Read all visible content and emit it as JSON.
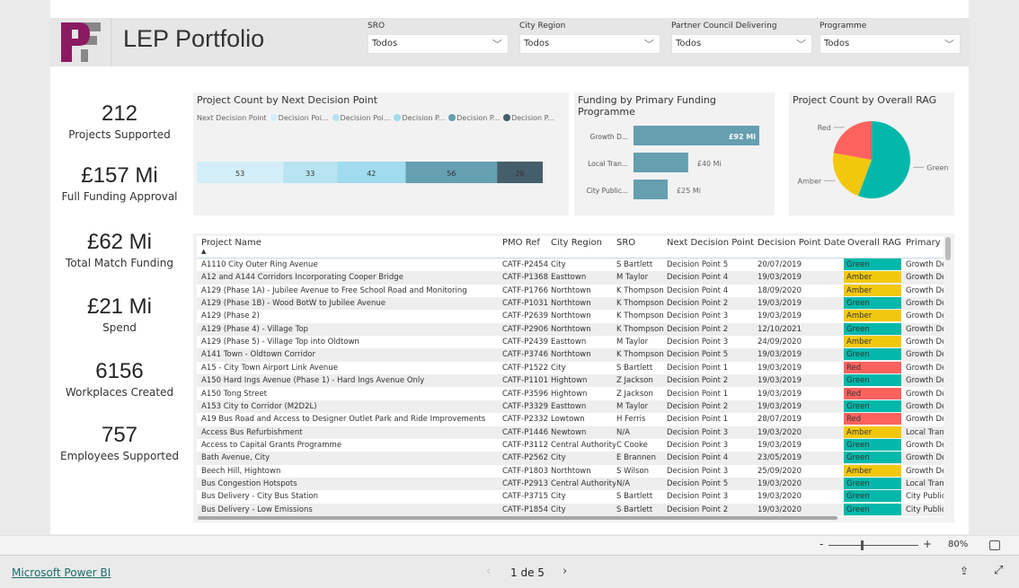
{
  "header": {
    "title": "LEP Portfolio",
    "logo_text": "PF",
    "filters": [
      {
        "label": "SRO",
        "value": "Todos"
      },
      {
        "label": "City Region",
        "value": "Todos"
      },
      {
        "label": "Partner Council Delivering",
        "value": "Todos"
      },
      {
        "label": "Programme",
        "value": "Todos"
      }
    ]
  },
  "kpis": [
    {
      "value": "212",
      "label": "Projects Supported"
    },
    {
      "value": "£157 Mi",
      "label": "Full Funding Approval"
    },
    {
      "value": "£62 Mi",
      "label": "Total Match Funding"
    },
    {
      "value": "£21 Mi",
      "label": "Spend"
    },
    {
      "value": "6156",
      "label": "Workplaces Created"
    },
    {
      "value": "757",
      "label": "Employees Supported"
    }
  ],
  "chart_data": [
    {
      "type": "bar",
      "orientation": "horizontal-stacked",
      "title": "Project Count by Next Decision Point",
      "legend_title": "Next Decision Point",
      "legend_position": "top",
      "legend_labels": [
        "Decision Poi...",
        "Decision Poi...",
        "Decision P...",
        "Decision P...",
        "Decision P..."
      ],
      "series": [
        {
          "name": "Decision Point 1",
          "value": 53,
          "color": "#d3eef8"
        },
        {
          "name": "Decision Point 2",
          "value": 33,
          "color": "#b8e3f2"
        },
        {
          "name": "Decision Point 3",
          "value": 42,
          "color": "#a0dbee"
        },
        {
          "name": "Decision Point 4",
          "value": 56,
          "color": "#659fb0"
        },
        {
          "name": "Decision Point 5",
          "value": 28,
          "color": "#445f6b"
        }
      ]
    },
    {
      "type": "bar",
      "orientation": "horizontal",
      "title": "Funding by Primary Funding Programme",
      "categories": [
        "Growth D...",
        "Local Tran...",
        "City Public..."
      ],
      "values": [
        92,
        40,
        25
      ],
      "data_labels": [
        "£92 Mi",
        "£40 Mi",
        "£25 Mi"
      ],
      "unit": "£ Mi",
      "color": "#659fb0"
    },
    {
      "type": "pie",
      "title": "Project Count by Overall RAG",
      "categories": [
        "Green",
        "Amber",
        "Red"
      ],
      "values": [
        118,
        47,
        47
      ],
      "colors": [
        "#01b8aa",
        "#f2c80f",
        "#fd625e"
      ]
    }
  ],
  "table": {
    "columns": [
      "Project Name",
      "PMO Ref",
      "City Region",
      "SRO",
      "Next Decision Point",
      "Decision Point Date",
      "Overall RAG",
      "Primary F"
    ],
    "sort_indicator": "▲",
    "rag_colors": {
      "Green": "#01b8aa",
      "Amber": "#f2c80f",
      "Red": "#fd625e"
    },
    "rows": [
      [
        "A1110 City Outer Ring Avenue",
        "CATF-P2454",
        "City",
        "S Bartlett",
        "Decision Point 5",
        "20/07/2019",
        "Green",
        "Growth Dea"
      ],
      [
        "A12 and A144 Corridors Incorporating Cooper Bridge",
        "CATF-P1368",
        "Easttown",
        "M Taylor",
        "Decision Point 4",
        "19/03/2019",
        "Amber",
        "Growth Dea"
      ],
      [
        "A129 (Phase 1A) - Jubilee Avenue to Free School Road and Monitoring",
        "CATF-P1766",
        "Northtown",
        "K Thompson",
        "Decision Point 4",
        "18/09/2020",
        "Amber",
        "Growth Dea"
      ],
      [
        "A129 (Phase 1B) - Wood BotW to Jubilee Avenue",
        "CATF-P1031",
        "Northtown",
        "K Thompson",
        "Decision Point 2",
        "19/03/2019",
        "Green",
        "Growth Dea"
      ],
      [
        "A129 (Phase 2)",
        "CATF-P2639",
        "Northtown",
        "K Thompson",
        "Decision Point 3",
        "19/03/2019",
        "Amber",
        "Growth Dea"
      ],
      [
        "A129 (Phase 4) - Village Top",
        "CATF-P2906",
        "Northtown",
        "K Thompson",
        "Decision Point 2",
        "12/10/2021",
        "Green",
        "Growth Dea"
      ],
      [
        "A129 (Phase 5) - Village Top into Oldtown",
        "CATF-P2439",
        "Easttown",
        "M Taylor",
        "Decision Point 3",
        "24/09/2020",
        "Amber",
        "Growth Dea"
      ],
      [
        "A141 Town - Oldtown Corridor",
        "CATF-P3746",
        "Northtown",
        "K Thompson",
        "Decision Point 5",
        "19/03/2019",
        "Green",
        "Growth Dea"
      ],
      [
        "A15 - City Town Airport Link Avenue",
        "CATF-P1522",
        "City",
        "S Bartlett",
        "Decision Point 1",
        "19/03/2019",
        "Red",
        "Growth Dea"
      ],
      [
        "A150 Hard Ings Avenue (Phase 1) - Hard Ings Avenue Only",
        "CATF-P1101",
        "Hightown",
        "Z Jackson",
        "Decision Point 2",
        "19/03/2019",
        "Green",
        "Growth Dea"
      ],
      [
        "A150 Tong Street",
        "CATF-P3596",
        "Hightown",
        "Z Jackson",
        "Decision Point 1",
        "19/03/2019",
        "Red",
        "Growth Dea"
      ],
      [
        "A153 City to Corridor (M2D2L)",
        "CATF-P3329",
        "Easttown",
        "M Taylor",
        "Decision Point 2",
        "19/03/2019",
        "Green",
        "Growth Dea"
      ],
      [
        "A19 Bus Road and Access to Designer Outlet Park and Ride Improvements",
        "CATF-P2332",
        "Lowtown",
        "H Ferris",
        "Decision Point 1",
        "28/07/2019",
        "Red",
        "Growth Dea"
      ],
      [
        "Access Bus Refurbishment",
        "CATF-P1446",
        "Newtown",
        "N/A",
        "Decision Point 3",
        "19/03/2020",
        "Amber",
        "Local Transp"
      ],
      [
        "Access to Capital Grants Programme",
        "CATF-P3112",
        "Central Authority",
        "C Cooke",
        "Decision Point 3",
        "19/03/2019",
        "Green",
        "Growth Dea"
      ],
      [
        "Bath Avenue, City",
        "CATF-P2562",
        "City",
        "E Brannen",
        "Decision Point 4",
        "23/05/2019",
        "Green",
        "Growth Dea"
      ],
      [
        "Beech Hill, Hightown",
        "CATF-P1803",
        "Northtown",
        "S Wilson",
        "Decision Point 3",
        "25/09/2020",
        "Amber",
        "Growth Dea"
      ],
      [
        "Bus Congestion Hotspots",
        "CATF-P2913",
        "Central Authority",
        "N/A",
        "Decision Point 5",
        "19/03/2020",
        "Green",
        "Local Transp"
      ],
      [
        "Bus Delivery - City Bus Station",
        "CATF-P3715",
        "City",
        "S Bartlett",
        "Decision Point 3",
        "19/03/2020",
        "Green",
        "City Public"
      ],
      [
        "Bus Delivery - Low Emissions",
        "CATF-P1854",
        "City",
        "S Bartlett",
        "Decision Point 2",
        "19/03/2020",
        "Green",
        "City Public"
      ]
    ]
  },
  "zoom": {
    "minus": "-",
    "plus": "+",
    "level": "80%",
    "level_value": 80
  },
  "footer": {
    "brand_link": "Microsoft Power BI",
    "page_indicator": "1 de 5"
  }
}
